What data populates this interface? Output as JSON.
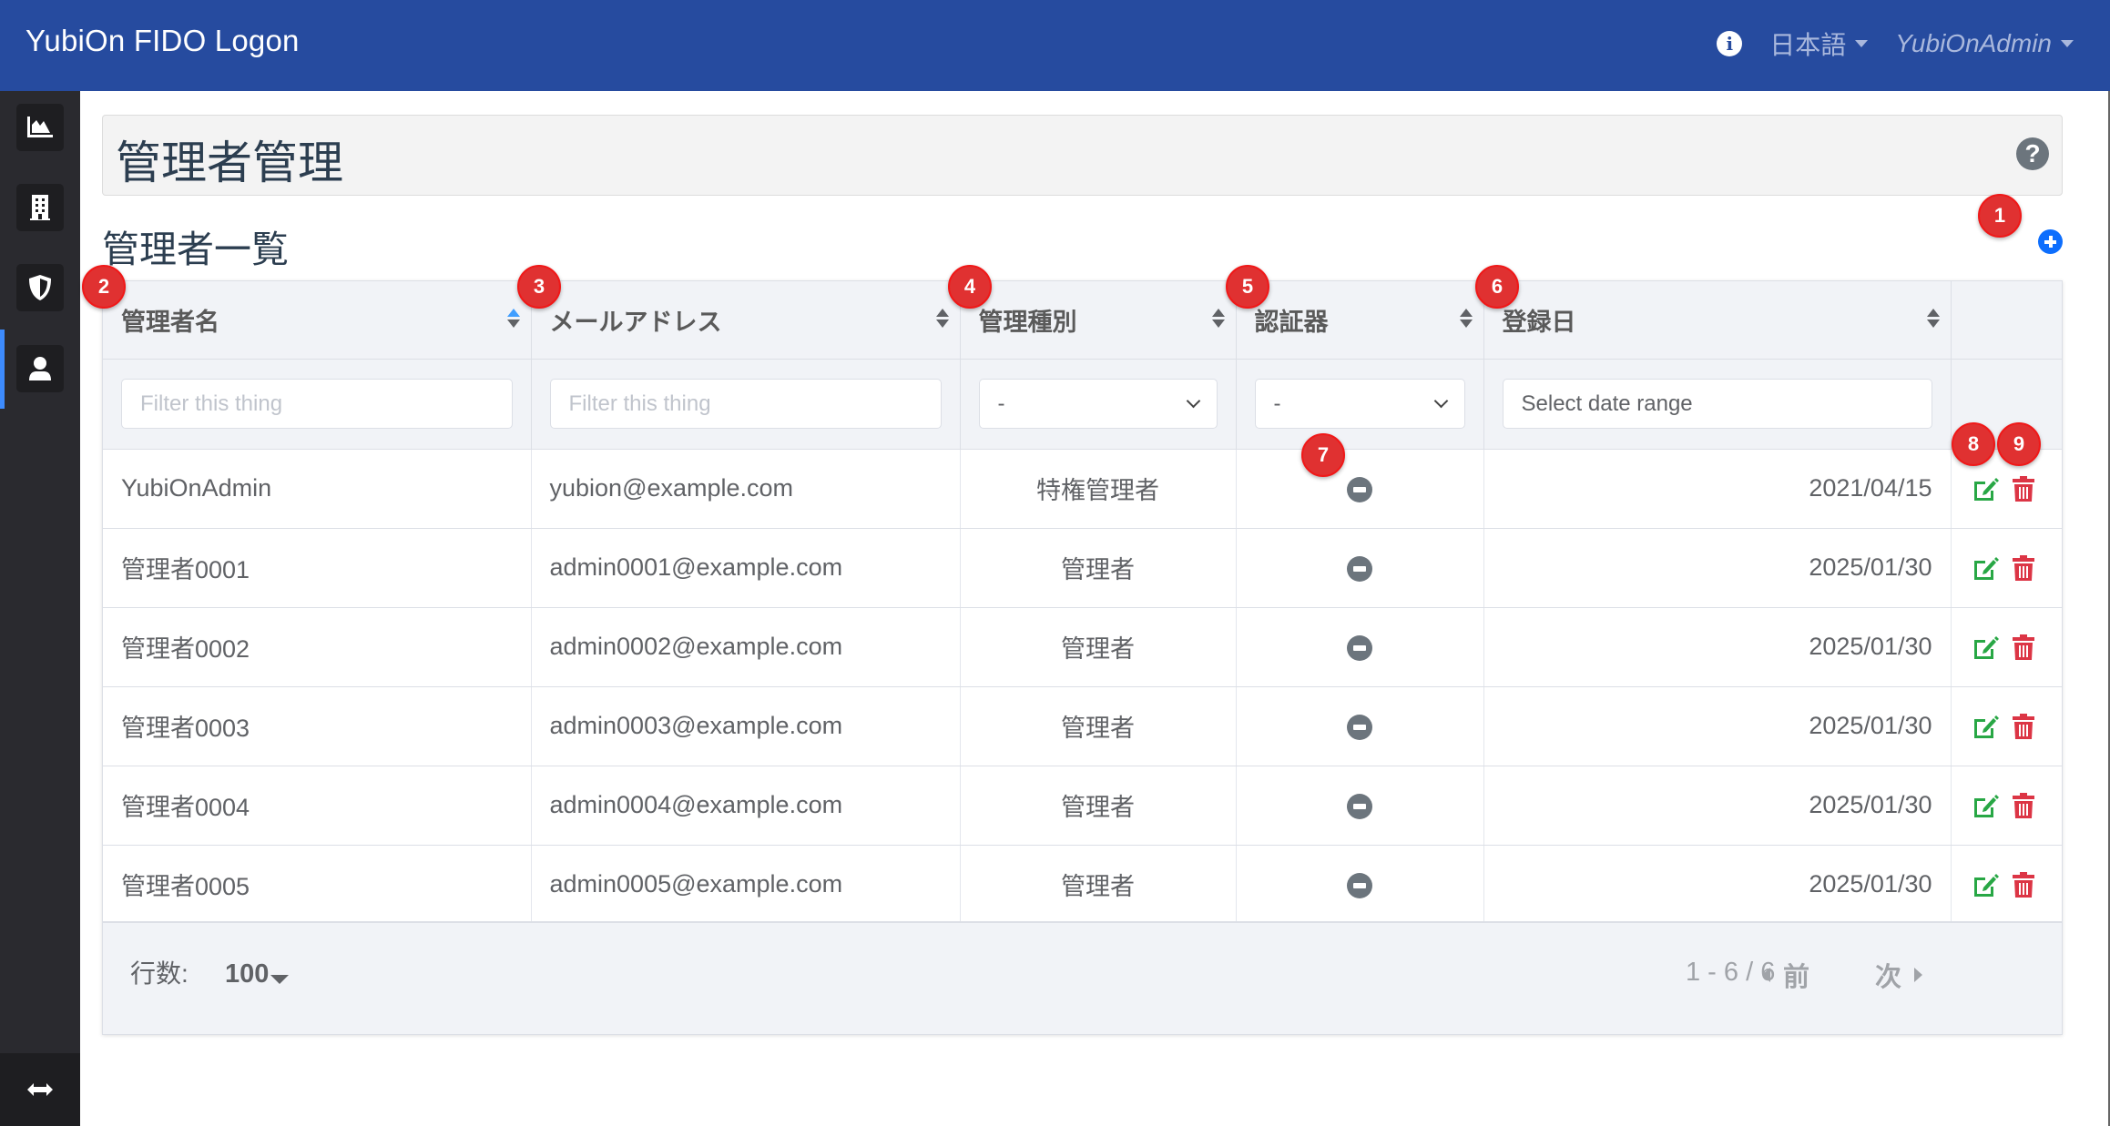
{
  "header": {
    "brand": "YubiOn FIDO Logon",
    "info_icon": "info-circle-icon",
    "language": "日本語",
    "user": "YubiOnAdmin"
  },
  "sidebar": {
    "items": [
      {
        "name": "dashboard",
        "icon": "area-chart-icon",
        "active": false
      },
      {
        "name": "organization",
        "icon": "building-icon",
        "active": false
      },
      {
        "name": "security",
        "icon": "shield-icon",
        "active": false
      },
      {
        "name": "administrators",
        "icon": "user-icon",
        "active": true
      }
    ],
    "toggle_icon": "arrows-horizontal-icon"
  },
  "page": {
    "title": "管理者管理",
    "help_icon": "question-circle-icon",
    "subheading": "管理者一覧",
    "add_icon": "plus-circle-icon"
  },
  "table": {
    "columns": [
      {
        "label": "管理者名",
        "sortable": true,
        "sort_active": "asc"
      },
      {
        "label": "メールアドレス",
        "sortable": true
      },
      {
        "label": "管理種別",
        "sortable": true
      },
      {
        "label": "認証器",
        "sortable": true
      },
      {
        "label": "登録日",
        "sortable": true
      },
      {
        "label": "",
        "sortable": false
      }
    ],
    "filters": {
      "name_placeholder": "Filter this thing",
      "email_placeholder": "Filter this thing",
      "type_value": "-",
      "authenticator_value": "-",
      "date_placeholder": "Select date range"
    },
    "rows": [
      {
        "name": "YubiOnAdmin",
        "email": "yubion@example.com",
        "type": "特権管理者",
        "authenticator": "none",
        "registered": "2021/04/15"
      },
      {
        "name": "管理者0001",
        "email": "admin0001@example.com",
        "type": "管理者",
        "authenticator": "none",
        "registered": "2025/01/30"
      },
      {
        "name": "管理者0002",
        "email": "admin0002@example.com",
        "type": "管理者",
        "authenticator": "none",
        "registered": "2025/01/30"
      },
      {
        "name": "管理者0003",
        "email": "admin0003@example.com",
        "type": "管理者",
        "authenticator": "none",
        "registered": "2025/01/30"
      },
      {
        "name": "管理者0004",
        "email": "admin0004@example.com",
        "type": "管理者",
        "authenticator": "none",
        "registered": "2025/01/30"
      },
      {
        "name": "管理者0005",
        "email": "admin0005@example.com",
        "type": "管理者",
        "authenticator": "none",
        "registered": "2025/01/30"
      }
    ],
    "row_actions": {
      "edit_icon": "edit-icon",
      "delete_icon": "trash-icon"
    }
  },
  "footer": {
    "rows_label": "行数:",
    "rows_value": "100",
    "range": "1 - 6 / 6",
    "prev": "前",
    "next": "次"
  },
  "annotations": [
    "1",
    "2",
    "3",
    "4",
    "5",
    "6",
    "7",
    "8",
    "9"
  ],
  "colors": {
    "header": "#264b9f",
    "sidebar": "#2a2a2f",
    "active_indicator": "#3d8bfd",
    "add": "#0d6efd",
    "edit": "#28a745",
    "delete": "#dc3545",
    "badge": "#e03131"
  }
}
